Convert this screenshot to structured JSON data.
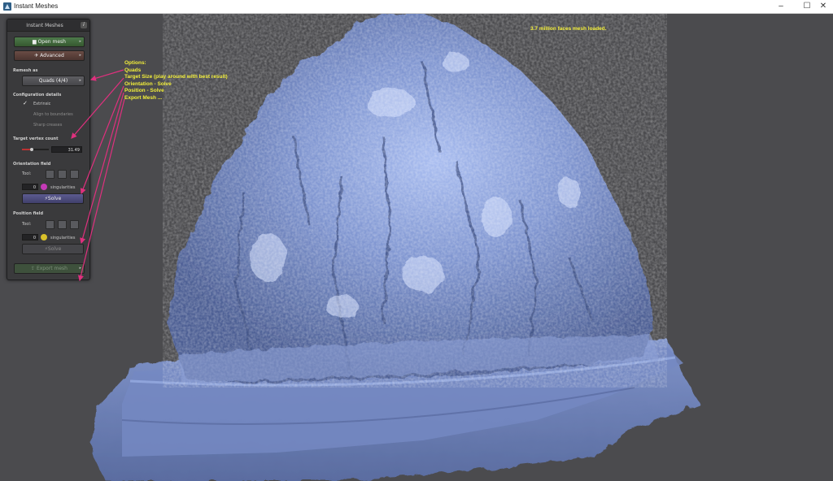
{
  "window": {
    "title": "Instant Meshes",
    "minimize": "–",
    "maximize": "☐",
    "close": "✕"
  },
  "panel": {
    "title": "Instant Meshes",
    "info": "i",
    "open_mesh": "Open mesh",
    "advanced": "Advanced",
    "remesh_as": {
      "label": "Remesh as",
      "value": "Quads (4/4)"
    },
    "config": {
      "label": "Configuration details",
      "extrinsic": "Extrinsic",
      "extrinsic_checked": true,
      "align": "Align to boundaries",
      "sharp": "Sharp creases"
    },
    "target_vertex": {
      "label": "Target vertex count",
      "value": "31.49",
      "fraction": 0.35
    },
    "orientation": {
      "label": "Orientation field",
      "tool": "Tool:",
      "count": "0",
      "singularities": "singularities",
      "solve": "Solve",
      "badge_color": "#c43ab6"
    },
    "position": {
      "label": "Position field",
      "tool": "Tool:",
      "count": "0",
      "singularities": "singularities",
      "solve": "Solve",
      "badge_color": "#d8c02a"
    },
    "export": "Export mesh"
  },
  "annotation": {
    "lines": [
      "Options:",
      "Quads",
      "Target Size (play around with best result)",
      "Orientation - Solve",
      "Position - Solve",
      "Export Mesh ..."
    ],
    "color": "#f2ee3a",
    "arrow_color": "#e0307e"
  },
  "status": "3.7 million faces mesh loaded.",
  "mesh_color": "#7a90cc"
}
